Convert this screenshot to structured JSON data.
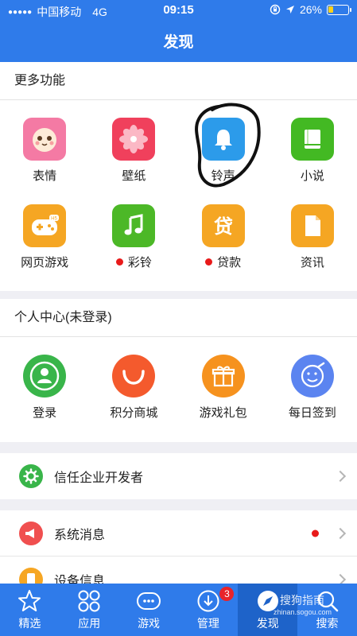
{
  "status_bar": {
    "carrier": "中国移动",
    "network": "4G",
    "time": "09:15",
    "battery": "26%",
    "battery_level": 0.26
  },
  "header": {
    "title": "发现"
  },
  "more": {
    "title": "更多功能",
    "items": [
      {
        "label": "表情",
        "icon": "emoji-face-icon",
        "color": "#f47aa4",
        "dot": false
      },
      {
        "label": "壁纸",
        "icon": "flower-wallpaper-icon",
        "color": "#f0405c",
        "dot": false
      },
      {
        "label": "铃声",
        "icon": "bell-icon",
        "color": "#2c9bea",
        "dot": false
      },
      {
        "label": "小说",
        "icon": "book-icon",
        "color": "#43b923",
        "dot": false
      },
      {
        "label": "网页游戏",
        "icon": "gamepad-icon",
        "color": "#f5a623",
        "dot": false
      },
      {
        "label": "彩铃",
        "icon": "music-note-icon",
        "color": "#4cb827",
        "dot": true
      },
      {
        "label": "贷款",
        "icon": "loan-icon",
        "color": "#f5a623",
        "dot": true
      },
      {
        "label": "资讯",
        "icon": "document-icon",
        "color": "#f5a623",
        "dot": false
      }
    ]
  },
  "personal": {
    "title": "个人中心(未登录)",
    "items": [
      {
        "label": "登录",
        "icon": "user-icon",
        "color": "#39b54a"
      },
      {
        "label": "积分商城",
        "icon": "smile-arc-icon",
        "color": "#f45a2d"
      },
      {
        "label": "游戏礼包",
        "icon": "gift-icon",
        "color": "#f6921e"
      },
      {
        "label": "每日签到",
        "icon": "signin-face-icon",
        "color": "#5b84f0"
      }
    ]
  },
  "list": [
    {
      "label": "信任企业开发者",
      "icon": "gear-icon",
      "color": "#39b54a",
      "dot": false
    },
    {
      "label": "系统消息",
      "icon": "megaphone-icon",
      "color": "#f04f4f",
      "dot": true
    },
    {
      "label": "设备信息",
      "icon": "device-icon",
      "color": "#f6a623",
      "dot": false
    }
  ],
  "tabs": [
    {
      "label": "精选",
      "icon": "star-icon"
    },
    {
      "label": "应用",
      "icon": "apps-grid-icon"
    },
    {
      "label": "游戏",
      "icon": "game-controller-icon"
    },
    {
      "label": "管理",
      "icon": "download-icon",
      "badge": "3"
    },
    {
      "label": "发现",
      "icon": "compass-icon"
    },
    {
      "label": "搜索",
      "icon": "search-icon"
    }
  ],
  "watermark": {
    "text": "搜狗指南",
    "sub": "zhinan.sogou.com"
  }
}
